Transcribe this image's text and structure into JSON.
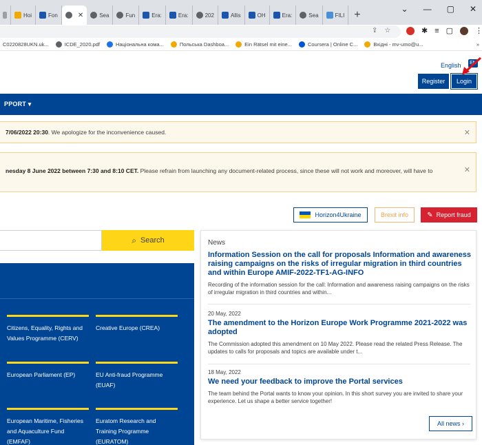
{
  "browser": {
    "tabs": [
      {
        "label": "Hoi",
        "color": "#f2a900",
        "active": false
      },
      {
        "label": "Fon",
        "color": "#1a56b0",
        "active": false
      },
      {
        "label": "",
        "color": "#5f6368",
        "active": true
      },
      {
        "label": "Sea",
        "color": "#5f6368",
        "active": false
      },
      {
        "label": "Fun",
        "color": "#5f6368",
        "active": false
      },
      {
        "label": "Era:",
        "color": "#1a56b0",
        "active": false
      },
      {
        "label": "Era:",
        "color": "#1a56b0",
        "active": false
      },
      {
        "label": "202",
        "color": "#5f6368",
        "active": false
      },
      {
        "label": "Allis",
        "color": "#1a56b0",
        "active": false
      },
      {
        "label": "OH",
        "color": "#1a56b0",
        "active": false
      },
      {
        "label": "Era:",
        "color": "#1a56b0",
        "active": false
      },
      {
        "label": "Sea",
        "color": "#5f6368",
        "active": false
      },
      {
        "label": "FILI",
        "color": "#4a90d9",
        "active": false
      }
    ],
    "new_tab": "+",
    "window_controls": [
      "⌄",
      "—",
      "▢",
      "✕"
    ],
    "bookmarks": [
      {
        "label": "C0220828UKN.uk...",
        "color": "#c0c0c0"
      },
      {
        "label": "ICDE_2020.pdf",
        "color": "#5f6368"
      },
      {
        "label": "Національна кома...",
        "color": "#1a73e8"
      },
      {
        "label": "Польська Dashboa...",
        "color": "#f2a900"
      },
      {
        "label": "Ein Rätsel mit eine...",
        "color": "#f2a900"
      },
      {
        "label": "Coursera | Online C...",
        "color": "#0056d2"
      },
      {
        "label": "Вхідні - mv-umo@u...",
        "color": "#f2a900"
      }
    ],
    "bookmarks_more": "»"
  },
  "header": {
    "language": "English",
    "language_badge": "EN",
    "register": "Register",
    "login": "Login"
  },
  "nav": {
    "support": "PPORT ▾"
  },
  "alerts": [
    {
      "bold": "7/06/2022 20:30",
      "text": ". We apologize for the inconvenience caused.",
      "close": "✕"
    },
    {
      "bold": "nesday 8 June 2022 between 7:30 and 8:10 CET.",
      "text": " Please refrain from launching any document-related process, since these will not work and moreover, will have to",
      "close": "✕"
    }
  ],
  "actions": {
    "horizon": "Horizon4Ukraine",
    "brexit": "Brexit info",
    "fraud": "Report fraud"
  },
  "search": {
    "button": "Search"
  },
  "programmes": [
    {
      "line1": "Citizens, Equality, Rights and",
      "line2": "Values Programme (CERV)"
    },
    {
      "line1": "Creative Europe (CREA)",
      "line2": ""
    },
    {
      "line1": "European Parliament (EP)",
      "line2": ""
    },
    {
      "line1": "EU Anti-fraud Programme",
      "line2": "(EUAF)"
    },
    {
      "line1": "European Maritime, Fisheries",
      "line2": "and Aquaculture Fund",
      "line3": "(EMFAF)"
    },
    {
      "line1": "Euratom Research and",
      "line2": "Training Programme",
      "line3": "(EURATOM)"
    }
  ],
  "news": {
    "label": "News",
    "items": [
      {
        "date": "",
        "title": "Information Session on the call for proposals Information and awareness raising campaigns on the risks of irregular migration in third countries and within Europe AMIF-2022-TF1-AG-INFO",
        "desc": "Recording of the information session for the call: Information and awareness raising campaigns on the risks of irregular migration in third countries and within..."
      },
      {
        "date": "20 May, 2022",
        "title": "The amendment to the Horizon Europe Work Programme 2021-2022 was adopted",
        "desc": "The Commission adopted this amendment on 10 May 2022. Please read the related Press Release. The updates to calls for proposals and topics are available under t..."
      },
      {
        "date": "18 May, 2022",
        "title": "We need your feedback to improve the Portal services",
        "desc": "The team behind the Portal wants to know your opinion. In this short survey you are invited to share your experience. Let us shape a better service together!"
      }
    ],
    "all_news": "All news ›"
  },
  "colors": {
    "primary": "#004494",
    "accent_yellow": "#ffd617",
    "fraud_red": "#d72231",
    "alert_bg": "#fdf8ec",
    "alert_border": "#f3cf8a"
  }
}
